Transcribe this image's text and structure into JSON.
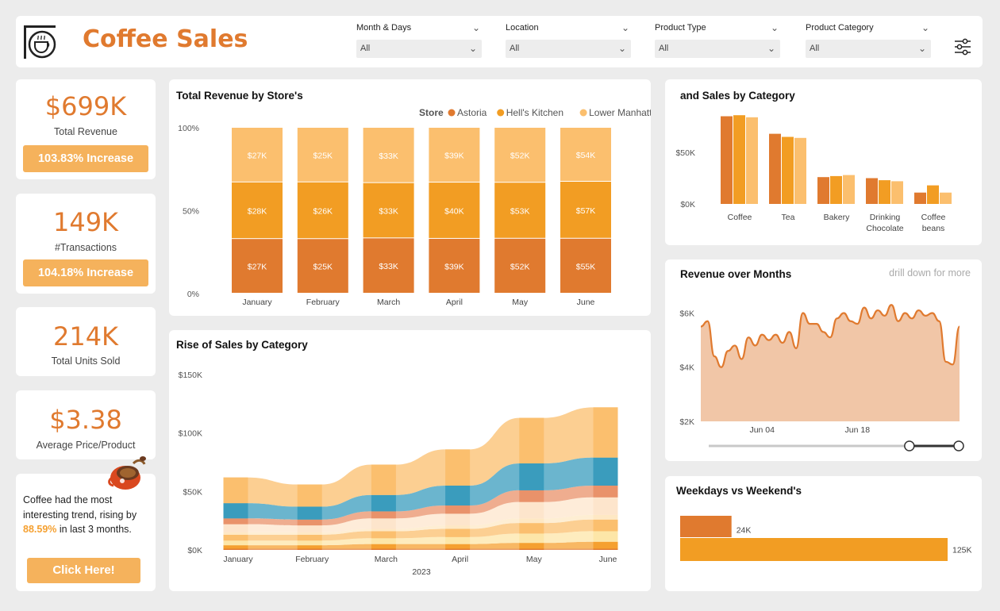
{
  "header": {
    "title": "Coffee Sales",
    "filters": [
      {
        "label": "Month & Days",
        "value": "All"
      },
      {
        "label": "Location",
        "value": "All"
      },
      {
        "label": "Product Type",
        "value": "All"
      },
      {
        "label": "Product Category",
        "value": "All"
      }
    ]
  },
  "kpis": [
    {
      "value": "$699K",
      "label": "Total Revenue",
      "badge": "103.83% Increase"
    },
    {
      "value": "149K",
      "label": "#Transactions",
      "badge": "104.18% Increase"
    },
    {
      "value": "214K",
      "label": "Total Units Sold"
    },
    {
      "value": "$3.38",
      "label": "Average Price/Product"
    }
  ],
  "insight": {
    "text_before": "Coffee had the most interesting trend, rising by ",
    "highlight": "88.59%",
    "text_after": " in last 3 months.",
    "cta": "Click Here!"
  },
  "colors": {
    "astoria": "#e07a2f",
    "hells_kitchen": "#f29d23",
    "lower_manhattan": "#fbbf6e",
    "teal": "#3a9cbd",
    "area": "#f1c6a7"
  },
  "chart_data": [
    {
      "id": "store-revenue",
      "type": "bar",
      "title": "Total Revenue by Store's",
      "legend_title": "Store",
      "legend_position": "top-right",
      "stacked": "100%",
      "categories": [
        "January",
        "February",
        "March",
        "April",
        "May",
        "June"
      ],
      "y_ticks": [
        "0%",
        "50%",
        "100%"
      ],
      "series": [
        {
          "name": "Astoria",
          "values": [
            27,
            25,
            33,
            39,
            52,
            55
          ],
          "labels": [
            "$27K",
            "$25K",
            "$33K",
            "$39K",
            "$52K",
            "$55K"
          ],
          "color": "#e07a2f"
        },
        {
          "name": "Hell's Kitchen",
          "values": [
            28,
            26,
            33,
            40,
            53,
            57
          ],
          "labels": [
            "$28K",
            "$26K",
            "$33K",
            "$40K",
            "$53K",
            "$57K"
          ],
          "color": "#f29d23"
        },
        {
          "name": "Lower Manhattan",
          "values": [
            27,
            25,
            33,
            39,
            52,
            54
          ],
          "labels": [
            "$27K",
            "$25K",
            "$33K",
            "$39K",
            "$52K",
            "$54K"
          ],
          "color": "#fbbf6e"
        }
      ]
    },
    {
      "id": "category-sales",
      "type": "bar",
      "title": "and Sales by Category",
      "categories": [
        "Coffee",
        "Tea",
        "Bakery",
        "Drinking Chocolate",
        "Coffee beans"
      ],
      "category_lines": [
        [
          "Coffee"
        ],
        [
          "Tea"
        ],
        [
          "Bakery"
        ],
        [
          "Drinking",
          "Chocolate"
        ],
        [
          "Coffee",
          "beans"
        ]
      ],
      "y_ticks": [
        {
          "label": "$0K",
          "value": 0
        },
        {
          "label": "$50K",
          "value": 50
        }
      ],
      "ylim": [
        0,
        90
      ],
      "series": [
        {
          "values": [
            85,
            68,
            26,
            25,
            11
          ],
          "color": "#e07a2f"
        },
        {
          "values": [
            86,
            65,
            27,
            23,
            18
          ],
          "color": "#f29d23"
        },
        {
          "values": [
            84,
            64,
            28,
            22,
            11
          ],
          "color": "#fbbf6e"
        }
      ]
    },
    {
      "id": "revenue-months",
      "type": "area",
      "title": "Revenue over Months",
      "subtitle": "drill down for more",
      "x_ticks": [
        {
          "label": "Jun 04",
          "index": 9
        },
        {
          "label": "Jun 18",
          "index": 23
        }
      ],
      "y_ticks": [
        {
          "label": "$2K",
          "value": 2
        },
        {
          "label": "$4K",
          "value": 4
        },
        {
          "label": "$6K",
          "value": 6
        }
      ],
      "ylim": [
        2,
        6.6
      ],
      "values": [
        5.5,
        5.7,
        4.4,
        4.0,
        4.6,
        4.8,
        4.3,
        5.1,
        4.8,
        5.2,
        5.0,
        5.2,
        4.9,
        5.3,
        4.7,
        6.0,
        5.6,
        5.6,
        5.3,
        5.1,
        5.8,
        6.0,
        5.7,
        5.6,
        6.2,
        5.8,
        6.1,
        5.9,
        6.3,
        5.7,
        6.0,
        5.8,
        6.1,
        5.9,
        6.0,
        5.7,
        4.2,
        4.1,
        5.5
      ],
      "slider": [
        0.8,
        1.0
      ]
    },
    {
      "id": "weekday-weekend",
      "type": "bar",
      "orientation": "horizontal",
      "title": "Weekdays vs Weekend's",
      "series": [
        {
          "values": [
            24,
            125
          ],
          "labels": [
            "24K",
            "125K"
          ],
          "colors": [
            "#e07a2f",
            "#f29d23"
          ]
        }
      ],
      "xlim": [
        0,
        140
      ]
    },
    {
      "id": "category-rise",
      "type": "area",
      "title": "Rise of Sales by Category",
      "x_ticks": [
        "January",
        "February",
        "March",
        "April",
        "May",
        "June"
      ],
      "xlabel": "2023",
      "y_ticks": [
        {
          "label": "$0K",
          "value": 0
        },
        {
          "label": "$50K",
          "value": 50
        },
        {
          "label": "$100K",
          "value": 100
        },
        {
          "label": "$150K",
          "value": 150
        }
      ],
      "ylim": [
        0,
        165
      ],
      "layers": [
        {
          "values": [
            1,
            1,
            1,
            1,
            1,
            1
          ],
          "color": "#e07a2f"
        },
        {
          "values": [
            3,
            3,
            4,
            4,
            5,
            6
          ],
          "color": "#f5a030"
        },
        {
          "values": [
            4,
            4,
            5,
            6,
            8,
            9
          ],
          "color": "#fde6a8"
        },
        {
          "values": [
            5,
            5,
            6,
            7,
            9,
            10
          ],
          "color": "#fbbf6e"
        },
        {
          "values": [
            2,
            2,
            2,
            3,
            4,
            4
          ],
          "color": "#fee8c4"
        },
        {
          "values": [
            7,
            6,
            9,
            10,
            14,
            15
          ],
          "color": "#fde5cc"
        },
        {
          "values": [
            5,
            5,
            6,
            7,
            10,
            10
          ],
          "color": "#e9926a"
        },
        {
          "values": [
            13,
            11,
            14,
            17,
            23,
            24
          ],
          "color": "#3a9cbd"
        },
        {
          "values": [
            22,
            19,
            26,
            31,
            39,
            43
          ],
          "color": "#fbbf6e"
        }
      ]
    }
  ]
}
